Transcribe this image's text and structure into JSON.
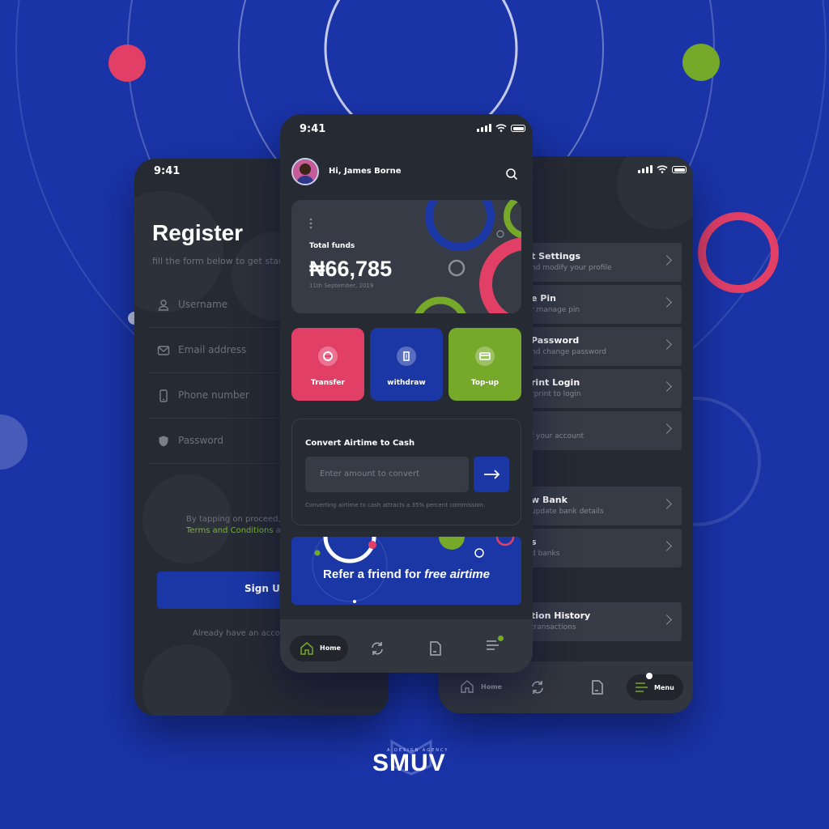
{
  "colors": {
    "background": "#1a34a8",
    "phone": "#262a33",
    "card": "#363b46",
    "accent_red": "#e23f67",
    "accent_blue": "#1b37a6",
    "accent_green": "#76a82a"
  },
  "register": {
    "time": "9:41",
    "title": "Register",
    "subtitle": "fill the form below to get started",
    "fields": [
      {
        "label": "Username",
        "icon": "user-icon"
      },
      {
        "label": "Email address",
        "icon": "mail-icon"
      },
      {
        "label": "Phone number",
        "icon": "phone-icon"
      },
      {
        "label": "Password",
        "icon": "shield-icon"
      }
    ],
    "terms_text": "By tapping on proceed, yo",
    "terms_link": "Terms and Conditions",
    "terms_after": " an",
    "signup_label": "Sign Up",
    "already_text": "Already have an accou"
  },
  "home": {
    "time": "9:41",
    "greeting": "Hi, James Borne",
    "card": {
      "label": "Total funds",
      "amount": "₦66,785",
      "date": "11th September, 2019"
    },
    "actions": [
      {
        "label": "Transfer",
        "icon": "transfer-icon"
      },
      {
        "label": "withdraw",
        "icon": "building-icon"
      },
      {
        "label": "Top-up",
        "icon": "card-icon"
      }
    ],
    "convert": {
      "title": "Convert Airtime to Cash",
      "placeholder": "Enter amount to convert",
      "note": "Converting airtime to cash attracts a 35% percent commission."
    },
    "refer": {
      "prefix": "Refer a friend for ",
      "emphasis": "free airtime"
    },
    "nav": {
      "home_label": "Home"
    }
  },
  "menu": {
    "items": [
      {
        "title": "t Settings",
        "subtitle": "nd modify your profile"
      },
      {
        "title": "e Pin",
        "subtitle": "r manage pin"
      },
      {
        "title": "Password",
        "subtitle": "nd change password"
      },
      {
        "title": "rint Login",
        "subtitle": "rprint to login"
      },
      {
        "title": "",
        "subtitle": "f your account"
      },
      {
        "title": "w Bank",
        "subtitle": "update bank details"
      },
      {
        "title": "s",
        "subtitle": "d banks"
      },
      {
        "title": "tion History",
        "subtitle": "transactions"
      }
    ],
    "nav": {
      "home_label": "Home",
      "menu_label": "Menu"
    }
  },
  "brand": {
    "logo": "SMUV",
    "tagline": "A DESIGN AGENCY"
  }
}
